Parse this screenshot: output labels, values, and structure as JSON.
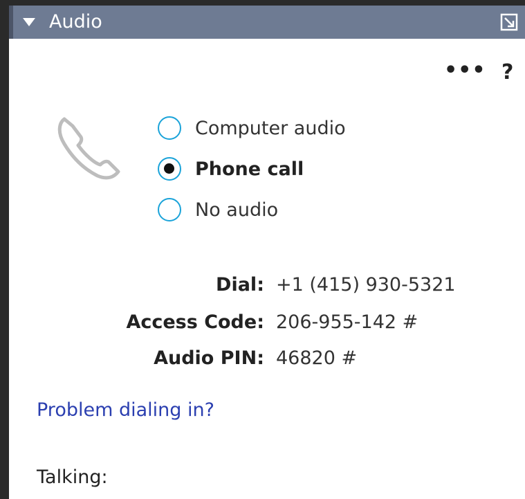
{
  "panel": {
    "title": "Audio",
    "icons": {
      "collapse": "caret-down-icon",
      "popout": "popout-icon",
      "more": "more-options-icon",
      "help": "help-icon",
      "phone": "phone-icon"
    },
    "more_label": "•••",
    "help_label": "?"
  },
  "audio_options": [
    {
      "label": "Computer audio",
      "selected": false
    },
    {
      "label": "Phone call",
      "selected": true
    },
    {
      "label": "No audio",
      "selected": false
    }
  ],
  "dial_info": {
    "dial_label": "Dial:",
    "dial_value": "+1 (415) 930-5321",
    "access_code_label": "Access Code:",
    "access_code_value": "206-955-142 #",
    "audio_pin_label": "Audio PIN:",
    "audio_pin_value": "46820 #"
  },
  "problem_link": "Problem dialing in?",
  "talking_label": "Talking:",
  "colors": {
    "header_bg": "#6e7b93",
    "radio_border": "#1aa3d9",
    "link": "#2b3fb0"
  }
}
